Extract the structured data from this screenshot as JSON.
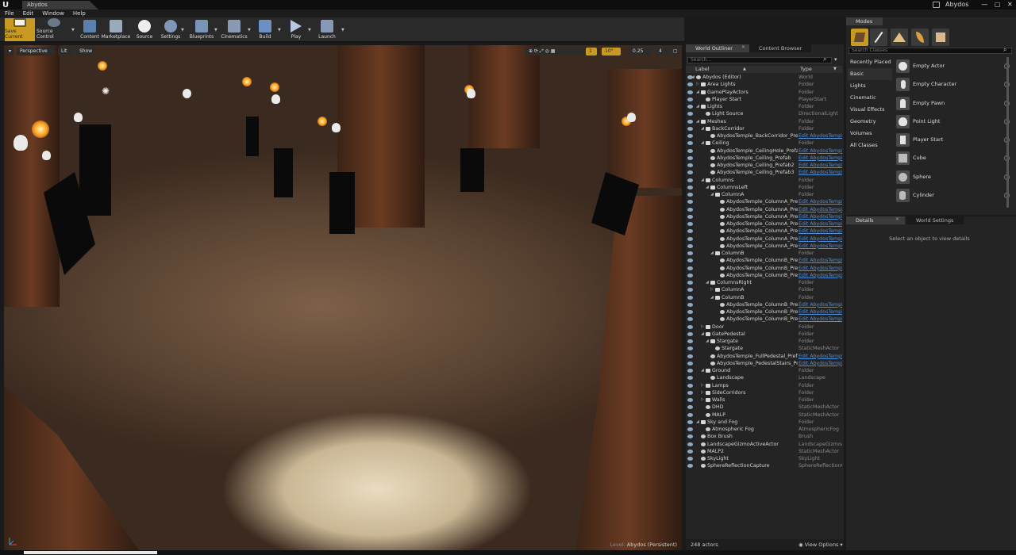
{
  "title_bar": {
    "logo": "U",
    "doc_tab": "Abydos",
    "project_name": "Abydos",
    "controls": [
      "—",
      "▢",
      "✕"
    ]
  },
  "menu": [
    "File",
    "Edit",
    "Window",
    "Help"
  ],
  "toolbar": {
    "buttons": [
      {
        "id": "save",
        "label": "Save Current",
        "icon": "save-icon"
      },
      {
        "id": "source-control",
        "label": "Source Control",
        "icon": "source-control-icon"
      },
      {
        "id": "content",
        "label": "Content",
        "icon": "content-icon"
      },
      {
        "id": "marketplace",
        "label": "Marketplace",
        "icon": "marketplace-icon"
      },
      {
        "id": "source",
        "label": "Source",
        "icon": "source-icon"
      },
      {
        "id": "settings",
        "label": "Settings",
        "icon": "gear-icon"
      },
      {
        "id": "blueprints",
        "label": "Blueprints",
        "icon": "blueprints-icon"
      },
      {
        "id": "cinematics",
        "label": "Cinematics",
        "icon": "clapper-icon"
      },
      {
        "id": "build",
        "label": "Build",
        "icon": "build-icon"
      },
      {
        "id": "play",
        "label": "Play",
        "icon": "play-icon"
      },
      {
        "id": "launch",
        "label": "Launch",
        "icon": "launch-icon"
      }
    ]
  },
  "viewport": {
    "perspective": "Perspective",
    "lit": "Lit",
    "show": "Show",
    "grid_snap": "10",
    "rotate_snap": "10°",
    "scale_snap": "0.25",
    "camera_speed": "4",
    "snap_count": "1",
    "level_label": "Level:",
    "level_name": "Abydos (Persistent)"
  },
  "outliner": {
    "tab": "World Outliner",
    "tab2": "Content Browser",
    "search_placeholder": "Search...",
    "col_label": "Label",
    "col_type": "Type",
    "rows": [
      {
        "d": 0,
        "e": "open",
        "i": "mesh",
        "l": "Abydos (Editor)",
        "t": "World",
        "k": 0
      },
      {
        "d": 1,
        "e": "closed",
        "i": "folder",
        "l": "Area Lights",
        "t": "Folder",
        "k": 0
      },
      {
        "d": 1,
        "e": "open",
        "i": "folder",
        "l": "GamePlayActors",
        "t": "Folder",
        "k": 0
      },
      {
        "d": 2,
        "e": "",
        "i": "mesh",
        "l": "Player Start",
        "t": "PlayerStart",
        "k": 0
      },
      {
        "d": 1,
        "e": "open",
        "i": "folder",
        "l": "Lights",
        "t": "Folder",
        "k": 0
      },
      {
        "d": 2,
        "e": "",
        "i": "mesh",
        "l": "Light Source",
        "t": "DirectionalLight",
        "k": 0
      },
      {
        "d": 1,
        "e": "open",
        "i": "folder",
        "l": "Meshes",
        "t": "Folder",
        "k": 0
      },
      {
        "d": 2,
        "e": "open",
        "i": "folder",
        "l": "BackCorridor",
        "t": "Folder",
        "k": 0
      },
      {
        "d": 3,
        "e": "",
        "i": "mesh",
        "l": "AbydosTemple_BackCorridor_Prefab",
        "t": "Edit AbydosTempl",
        "k": 1
      },
      {
        "d": 2,
        "e": "open",
        "i": "folder",
        "l": "Ceiling",
        "t": "Folder",
        "k": 0
      },
      {
        "d": 3,
        "e": "",
        "i": "mesh",
        "l": "AbydosTemple_CeilingHole_Prefab",
        "t": "Edit AbydosTempl",
        "k": 1
      },
      {
        "d": 3,
        "e": "",
        "i": "mesh",
        "l": "AbydosTemple_Ceiling_Prefab",
        "t": "Edit AbydosTempl",
        "k": 1
      },
      {
        "d": 3,
        "e": "",
        "i": "mesh",
        "l": "AbydosTemple_Ceiling_Prefab2",
        "t": "Edit AbydosTempl",
        "k": 1
      },
      {
        "d": 3,
        "e": "",
        "i": "mesh",
        "l": "AbydosTemple_Ceiling_Prefab3",
        "t": "Edit AbydosTempl",
        "k": 1
      },
      {
        "d": 2,
        "e": "open",
        "i": "folder",
        "l": "Columns",
        "t": "Folder",
        "k": 0
      },
      {
        "d": 3,
        "e": "open",
        "i": "folder",
        "l": "ColumnsLeft",
        "t": "Folder",
        "k": 0
      },
      {
        "d": 4,
        "e": "open",
        "i": "folder",
        "l": "ColumnA",
        "t": "Folder",
        "k": 0
      },
      {
        "d": 5,
        "e": "",
        "i": "mesh",
        "l": "AbydosTemple_ColumnA_Prefab",
        "t": "Edit AbydosTempl",
        "k": 1
      },
      {
        "d": 5,
        "e": "",
        "i": "mesh",
        "l": "AbydosTemple_ColumnA_Prefab",
        "t": "Edit AbydosTempl",
        "k": 1
      },
      {
        "d": 5,
        "e": "",
        "i": "mesh",
        "l": "AbydosTemple_ColumnA_Prefab",
        "t": "Edit AbydosTempl",
        "k": 1
      },
      {
        "d": 5,
        "e": "",
        "i": "mesh",
        "l": "AbydosTemple_ColumnA_Prefab",
        "t": "Edit AbydosTempl",
        "k": 1
      },
      {
        "d": 5,
        "e": "",
        "i": "mesh",
        "l": "AbydosTemple_ColumnA_Prefab",
        "t": "Edit AbydosTempl",
        "k": 1
      },
      {
        "d": 5,
        "e": "",
        "i": "mesh",
        "l": "AbydosTemple_ColumnA_Prefab",
        "t": "Edit AbydosTempl",
        "k": 1
      },
      {
        "d": 5,
        "e": "",
        "i": "mesh",
        "l": "AbydosTemple_ColumnA_Prefab",
        "t": "Edit AbydosTempl",
        "k": 1
      },
      {
        "d": 4,
        "e": "open",
        "i": "folder",
        "l": "ColumnB",
        "t": "Folder",
        "k": 0
      },
      {
        "d": 5,
        "e": "",
        "i": "mesh",
        "l": "AbydosTemple_ColumnB_Prefab",
        "t": "Edit AbydosTempl",
        "k": 1
      },
      {
        "d": 5,
        "e": "",
        "i": "mesh",
        "l": "AbydosTemple_ColumnB_Prefab",
        "t": "Edit AbydosTempl",
        "k": 1
      },
      {
        "d": 5,
        "e": "",
        "i": "mesh",
        "l": "AbydosTemple_ColumnB_Prefab",
        "t": "Edit AbydosTempl",
        "k": 1
      },
      {
        "d": 3,
        "e": "open",
        "i": "folder",
        "l": "ColumnsRight",
        "t": "Folder",
        "k": 0
      },
      {
        "d": 4,
        "e": "closed",
        "i": "folder",
        "l": "ColumnA",
        "t": "Folder",
        "k": 0
      },
      {
        "d": 4,
        "e": "open",
        "i": "folder",
        "l": "ColumnB",
        "t": "Folder",
        "k": 0
      },
      {
        "d": 5,
        "e": "",
        "i": "mesh",
        "l": "AbydosTemple_ColumnB_Prefab",
        "t": "Edit AbydosTempl",
        "k": 1
      },
      {
        "d": 5,
        "e": "",
        "i": "mesh",
        "l": "AbydosTemple_ColumnB_Prefab",
        "t": "Edit AbydosTempl",
        "k": 1
      },
      {
        "d": 5,
        "e": "",
        "i": "mesh",
        "l": "AbydosTemple_ColumnB_Prefab",
        "t": "Edit AbydosTempl",
        "k": 1
      },
      {
        "d": 2,
        "e": "closed",
        "i": "folder",
        "l": "Door",
        "t": "Folder",
        "k": 0
      },
      {
        "d": 2,
        "e": "open",
        "i": "folder",
        "l": "GatePedestal",
        "t": "Folder",
        "k": 0
      },
      {
        "d": 3,
        "e": "open",
        "i": "folder",
        "l": "Stargate",
        "t": "Folder",
        "k": 0
      },
      {
        "d": 4,
        "e": "",
        "i": "mesh",
        "l": "Stargate",
        "t": "StaticMeshActor",
        "k": 0
      },
      {
        "d": 3,
        "e": "",
        "i": "mesh",
        "l": "AbydosTemple_FullPedestal_Prefab",
        "t": "Edit AbydosTempl",
        "k": 1
      },
      {
        "d": 3,
        "e": "",
        "i": "mesh",
        "l": "AbydosTemple_PedestalStairs_Prefab",
        "t": "Edit AbydosTempl",
        "k": 1
      },
      {
        "d": 2,
        "e": "open",
        "i": "folder",
        "l": "Ground",
        "t": "Folder",
        "k": 0
      },
      {
        "d": 3,
        "e": "",
        "i": "mesh",
        "l": "Landscape",
        "t": "Landscape",
        "k": 0
      },
      {
        "d": 2,
        "e": "closed",
        "i": "folder",
        "l": "Lamps",
        "t": "Folder",
        "k": 0
      },
      {
        "d": 2,
        "e": "closed",
        "i": "folder",
        "l": "SideCorridors",
        "t": "Folder",
        "k": 0
      },
      {
        "d": 2,
        "e": "closed",
        "i": "folder",
        "l": "Walls",
        "t": "Folder",
        "k": 0
      },
      {
        "d": 2,
        "e": "",
        "i": "mesh",
        "l": "DHD",
        "t": "StaticMeshActor",
        "k": 0
      },
      {
        "d": 2,
        "e": "",
        "i": "mesh",
        "l": "MALP",
        "t": "StaticMeshActor",
        "k": 0
      },
      {
        "d": 1,
        "e": "open",
        "i": "folder",
        "l": "Sky and Fog",
        "t": "Folder",
        "k": 0
      },
      {
        "d": 2,
        "e": "",
        "i": "mesh",
        "l": "Atmospheric Fog",
        "t": "AtmosphericFog",
        "k": 0
      },
      {
        "d": 1,
        "e": "",
        "i": "mesh",
        "l": "Box Brush",
        "t": "Brush",
        "k": 0
      },
      {
        "d": 1,
        "e": "",
        "i": "mesh",
        "l": "LandscapeGizmoActiveActor",
        "t": "LandscapeGizmoAc",
        "k": 0
      },
      {
        "d": 1,
        "e": "",
        "i": "mesh",
        "l": "MALP2",
        "t": "StaticMeshActor",
        "k": 0
      },
      {
        "d": 1,
        "e": "",
        "i": "mesh",
        "l": "SkyLight",
        "t": "SkyLight",
        "k": 0
      },
      {
        "d": 1,
        "e": "",
        "i": "mesh",
        "l": "SphereReflectionCapture",
        "t": "SphereReflectionCa",
        "k": 0
      }
    ],
    "actor_count": "248 actors",
    "view_options": "View Options"
  },
  "modes": {
    "tab": "Modes",
    "search_placeholder": "Search Classes",
    "mode_icons": [
      "place-mode-icon",
      "paint-mode-icon",
      "landscape-mode-icon",
      "foliage-mode-icon",
      "geometry-mode-icon"
    ],
    "categories": [
      "Recently Placed",
      "Basic",
      "Lights",
      "Cinematic",
      "Visual Effects",
      "Geometry",
      "Volumes",
      "All Classes"
    ],
    "selected_category": "Basic",
    "items": [
      "Empty Actor",
      "Empty Character",
      "Empty Pawn",
      "Point Light",
      "Player Start",
      "Cube",
      "Sphere",
      "Cylinder"
    ]
  },
  "details": {
    "tab": "Details",
    "tab2": "World Settings",
    "empty_text": "Select an object to view details"
  },
  "colors": {
    "save_accent": "#c89a22",
    "link": "#4f8fd8"
  }
}
